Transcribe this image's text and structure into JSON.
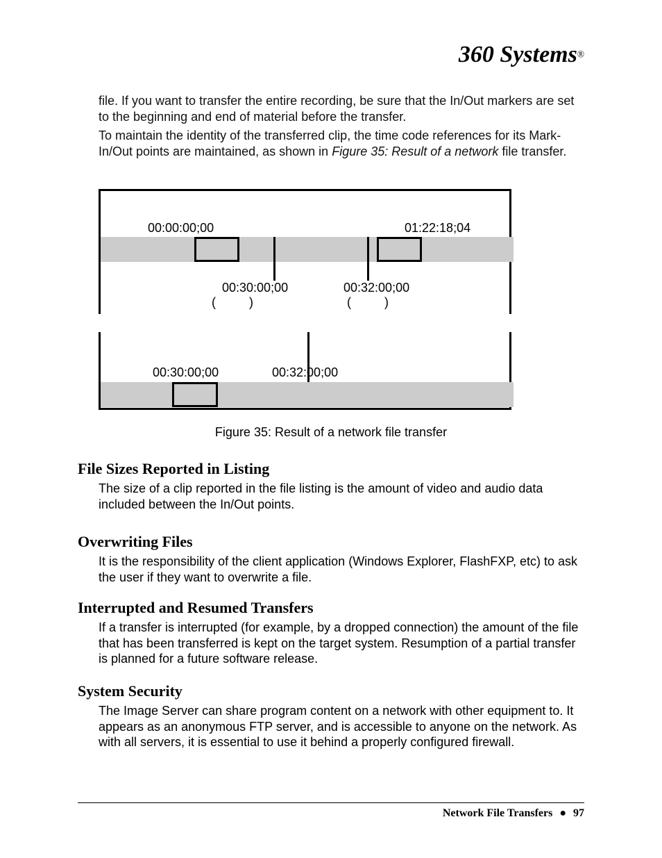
{
  "logo": {
    "text": "360 Systems",
    "mark": "®"
  },
  "para1": "file.  If you want to transfer the entire recording, be sure that the In/Out markers are set to the beginning and end of material before the transfer.",
  "para2_a": "To maintain the identity of the transferred clip, the time code references for its Mark-In/Out points are maintained, as shown in ",
  "para2_em": "Figure 35:  Result of a network",
  "para2_b": " file transfer.",
  "diagram": {
    "top": {
      "start_tc": "00:00:00;00",
      "end_tc": "01:22:18;04",
      "in_tc": "00:30:00;00",
      "out_tc": "00:32:00;00",
      "mark_in_open": "(",
      "mark_in_close": ")",
      "mark_out_open": "(",
      "mark_out_close": ")"
    },
    "bottom": {
      "in_tc": "00:30:00;00",
      "out_tc": "00:32:00;00"
    }
  },
  "caption": "Figure 35:  Result of a network file transfer",
  "sections": {
    "s1": {
      "h": "File Sizes Reported in Listing",
      "p": "The size of a clip reported in the file listing is the amount of video and audio data included between the In/Out points."
    },
    "s2": {
      "h": "Overwriting Files",
      "p": "It is the responsibility of the client application (Windows Explorer, FlashFXP, etc) to ask the user if they want to overwrite a file."
    },
    "s3": {
      "h": "Interrupted and Resumed Transfers",
      "p": "If a transfer is interrupted (for example, by a dropped connection) the amount of the file that has been transferred is kept on the target system.  Resumption of a partial transfer is planned for a future software release."
    },
    "s4": {
      "h": "System Security",
      "p": "The Image Server can share program content on a network with other equipment to.  It appears as an anonymous FTP server, and is accessible to anyone on the network.  As with all servers, it is essential to use it behind a properly configured firewall."
    }
  },
  "footer": {
    "title": "Network File Transfers",
    "bullet": "●",
    "page": "97"
  }
}
